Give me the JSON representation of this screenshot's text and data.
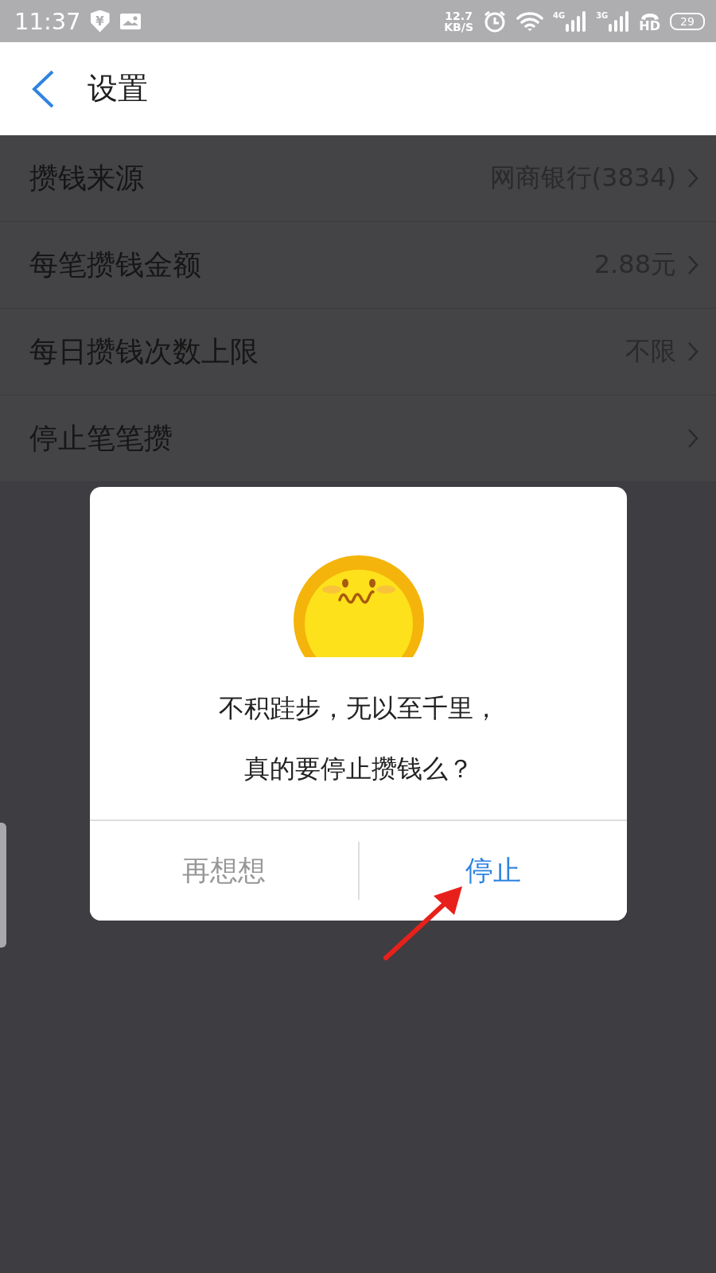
{
  "status_bar": {
    "time": "11:37",
    "shield_symbol": "¥",
    "net_speed": "12.7",
    "net_speed_unit": "KB/S",
    "sim1_type": "4G",
    "sim2_type": "3G",
    "hd_label": "HD",
    "battery": "29"
  },
  "header": {
    "title": "设置"
  },
  "settings": [
    {
      "label": "攒钱来源",
      "value": "网商银行(3834)"
    },
    {
      "label": "每笔攒钱金额",
      "value": "2.88元"
    },
    {
      "label": "每日攒钱次数上限",
      "value": "不限"
    },
    {
      "label": "停止笔笔攒"
    }
  ],
  "dialog": {
    "message_lines": [
      "不积跬步，无以至千里，",
      "真的要停止攒钱么？"
    ],
    "buttons": [
      {
        "label": "再想想",
        "kind": "secondary"
      },
      {
        "label": "停止",
        "kind": "primary"
      }
    ]
  }
}
